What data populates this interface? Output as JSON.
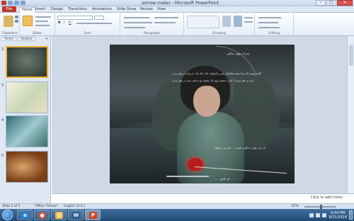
{
  "window": {
    "title": "sorrow maker - Microsoft PowerPoint",
    "controls": {
      "minimize": "–",
      "maximize": "□",
      "close": "✕"
    }
  },
  "ribbon_tabs": [
    "File",
    "Home",
    "Insert",
    "Design",
    "Transitions",
    "Animations",
    "Slide Show",
    "Review",
    "View"
  ],
  "ribbon": {
    "groups": [
      {
        "label": "Clipboard"
      },
      {
        "label": "Slides"
      },
      {
        "label": "Font"
      },
      {
        "label": "Paragraph"
      },
      {
        "label": "Drawing"
      },
      {
        "label": "Editing"
      }
    ]
  },
  "left_pane": {
    "tabs": [
      "Slides",
      "Outline"
    ],
    "close_glyph": "✕",
    "thumbnails": [
      {
        "num": "2",
        "selected": true
      },
      {
        "num": "3",
        "selected": false
      },
      {
        "num": "4",
        "selected": false
      },
      {
        "num": "5",
        "selected": false
      }
    ]
  },
  "slide_text": {
    "line1": "پسرک تنهای غمگین",
    "line2": "گفته بودی که چرا محو تماشای منی و آنچنان مات که یک دم مژه بر هم نزنی",
    "line3": "مژه بر هم نزنم تا که ز دستم نرود ناز چشم تو به قدر مژه بر هم زدنی",
    "line4": "دل من تنها و غمگین است ... دلم می خواهد",
    "line5": "..... ای کاش ...."
  },
  "notes": {
    "placeholder": "Click to add notes"
  },
  "statusbar": {
    "slide_info": "Slide 2 of 5",
    "theme": "\"Office Theme\"",
    "language": "English (U.S.)",
    "zoom": "67%"
  },
  "taskbar": {
    "apps": [
      {
        "name": "internet-explorer",
        "glyph": "e",
        "color": "#2a7fd4"
      },
      {
        "name": "chrome",
        "glyph": "●",
        "color": "#dd4b39"
      },
      {
        "name": "file-explorer",
        "glyph": "▤",
        "color": "#e8b84a"
      },
      {
        "name": "word",
        "glyph": "W",
        "color": "#2b5797"
      },
      {
        "name": "powerpoint",
        "glyph": "P",
        "color": "#d24726"
      }
    ],
    "time": "6:54 PM",
    "date": "9/21/2014"
  },
  "colors": {
    "accent": "#2b5797",
    "file_tab": "#c0392b",
    "selection": "#f2b233"
  }
}
